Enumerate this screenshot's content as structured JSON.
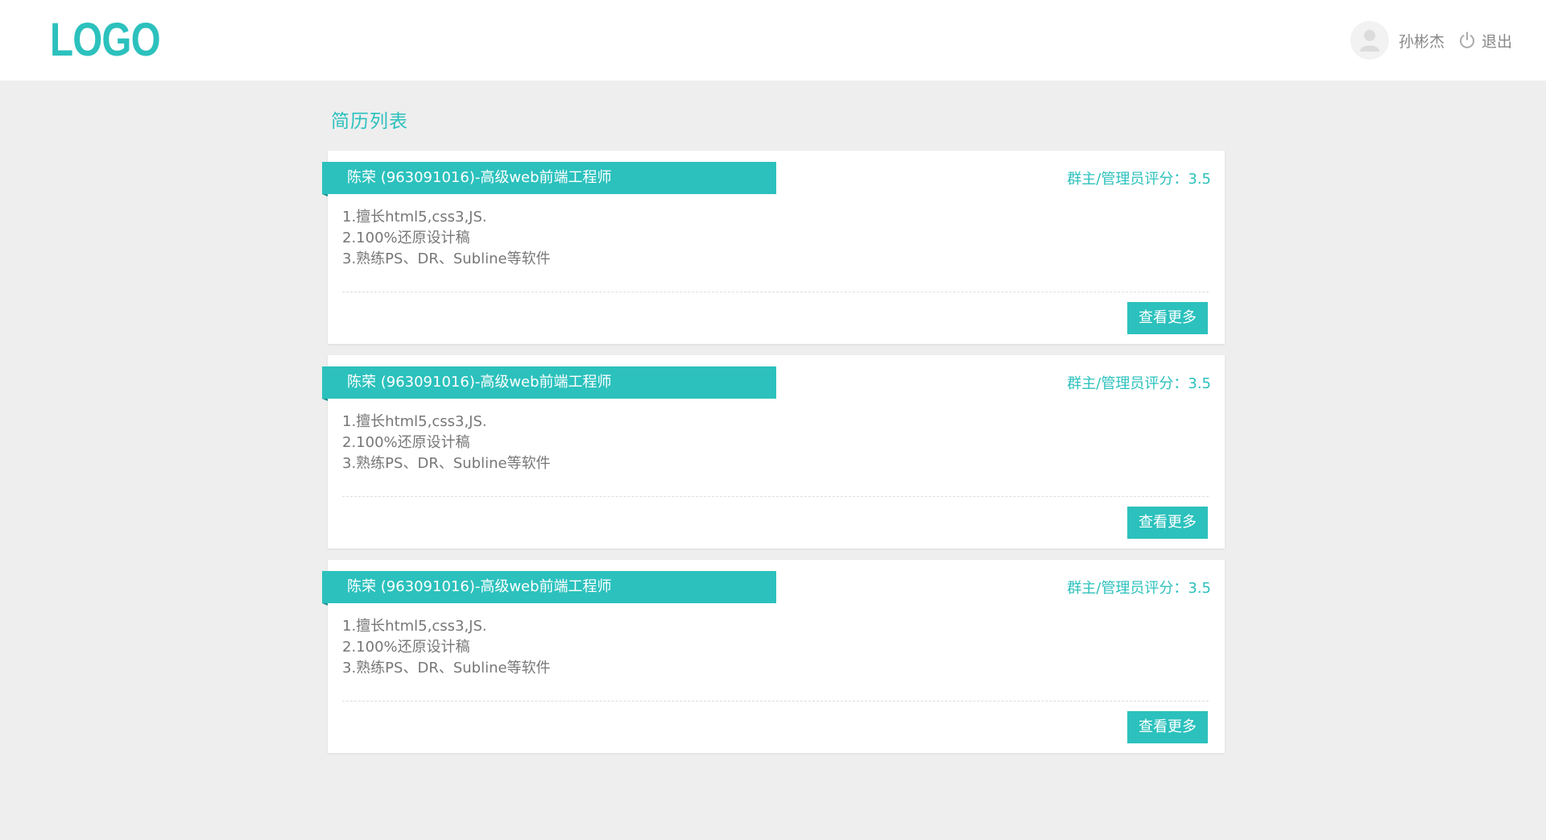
{
  "header": {
    "logo": "LOGO",
    "user_name": "孙彬杰",
    "logout_label": "退出"
  },
  "page": {
    "title": "简历列表"
  },
  "resumes": [
    {
      "title": "陈荣 (963091016)-高级web前端工程师",
      "score": "群主/管理员评分：3.5",
      "lines": [
        "1.擅长html5,css3,JS.",
        "2.100%还原设计稿",
        "3.熟练PS、DR、Subline等软件"
      ],
      "more_label": "查看更多"
    },
    {
      "title": "陈荣 (963091016)-高级web前端工程师",
      "score": "群主/管理员评分：3.5",
      "lines": [
        "1.擅长html5,css3,JS.",
        "2.100%还原设计稿",
        "3.熟练PS、DR、Subline等软件"
      ],
      "more_label": "查看更多"
    },
    {
      "title": "陈荣 (963091016)-高级web前端工程师",
      "score": "群主/管理员评分：3.5",
      "lines": [
        "1.擅长html5,css3,JS.",
        "2.100%还原设计稿",
        "3.熟练PS、DR、Subline等软件"
      ],
      "more_label": "查看更多"
    }
  ],
  "icons": {
    "avatar": "user-avatar-icon",
    "logout": "power-icon"
  },
  "colors": {
    "accent": "#2cc1bd",
    "background": "#eeeeee",
    "card": "#ffffff"
  }
}
